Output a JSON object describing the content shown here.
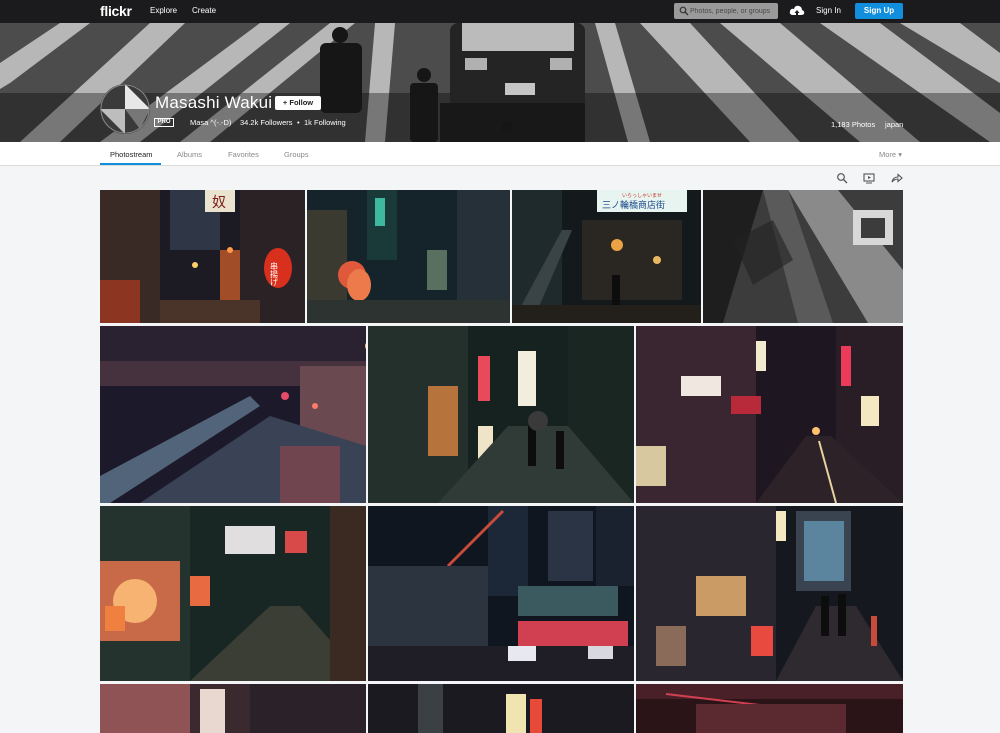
{
  "nav": {
    "logo": "flickr",
    "explore": "Explore",
    "create": "Create",
    "search_placeholder": "Photos, people, or groups",
    "sign_in": "Sign In",
    "sign_up": "Sign Up"
  },
  "profile": {
    "name": "Masashi Wakui",
    "follow_label": "Follow",
    "pro_label": "PRO",
    "alias": "Masa ^(-.-D)",
    "followers": "34.2k Followers",
    "following": "1k Following",
    "photos_count": "1,183 Photos",
    "location": "japan"
  },
  "tabs": {
    "photostream": "Photostream",
    "albums": "Albums",
    "favorites": "Favorites",
    "groups": "Groups",
    "more": "More"
  },
  "sign_text": {
    "kanji_sign": "奴",
    "lantern": "串揚げ",
    "shop_sign": "三ノ輪橋商店街",
    "shop_small": "いらっしゃいませ"
  },
  "colors": {
    "accent": "#128fdc",
    "topbar": "#1b1b1d"
  }
}
